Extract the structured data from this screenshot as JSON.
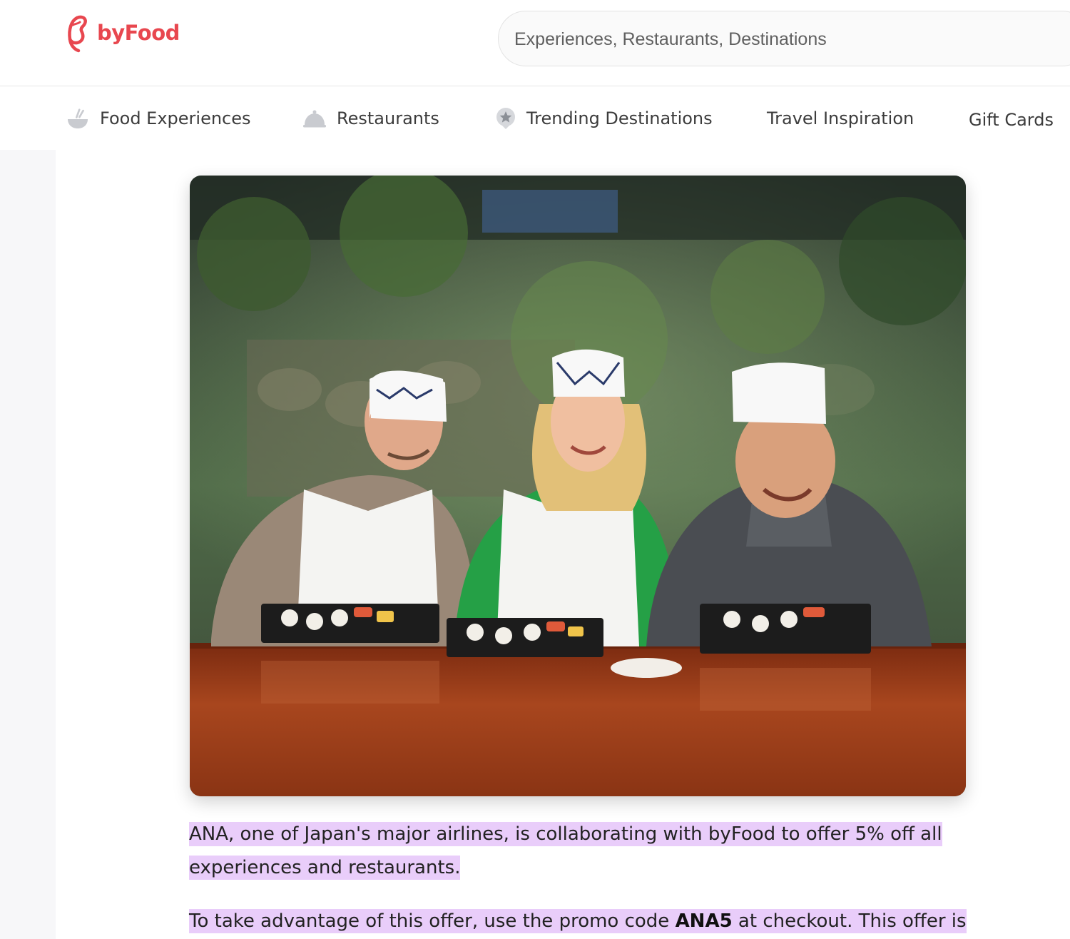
{
  "brand": {
    "name": "byFood",
    "accent_color": "#e8474f",
    "logo_icon": "byfood-swirl-logo"
  },
  "search": {
    "placeholder": "Experiences, Restaurants, Destinations"
  },
  "nav": {
    "items": [
      {
        "label": "Food Experiences",
        "icon": "bowl-icon"
      },
      {
        "label": "Restaurants",
        "icon": "cloche-icon"
      },
      {
        "label": "Trending Destinations",
        "icon": "star-badge-icon"
      },
      {
        "label": "Travel Inspiration",
        "icon": ""
      },
      {
        "label": "Gift Cards",
        "icon": ""
      }
    ]
  },
  "hero_image": {
    "alt": ""
  },
  "article": {
    "para1": "ANA, one of Japan's major airlines, is collaborating with byFood to offer 5% off all experiences and restaurants.",
    "para2_before": "To take advantage of this offer, use the promo code ",
    "para2_code": "ANA5",
    "para2_after": " at checkout. This offer is",
    "highlight_color": "#e9cdfa"
  }
}
